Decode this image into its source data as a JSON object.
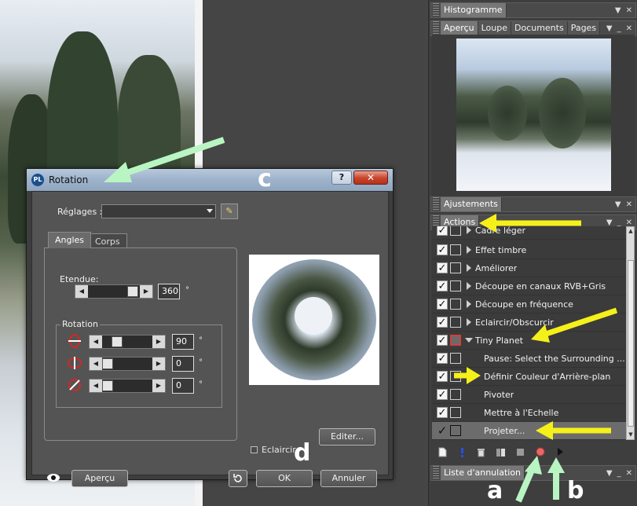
{
  "panels": {
    "histogram": {
      "title": "Histogramme"
    },
    "navigator": {
      "tabs": [
        "Aperçu",
        "Loupe",
        "Documents",
        "Pages"
      ]
    },
    "adjustments": {
      "title": "Ajustements"
    },
    "actions": {
      "title": "Actions",
      "items": [
        {
          "label": "Cadre léger",
          "type": "group",
          "checked": true
        },
        {
          "label": "Effet timbre",
          "type": "group",
          "checked": true
        },
        {
          "label": "Améliorer",
          "type": "group",
          "checked": true
        },
        {
          "label": "Découpe en canaux RVB+Gris",
          "type": "group",
          "checked": true
        },
        {
          "label": "Découpe en fréquence",
          "type": "group",
          "checked": true
        },
        {
          "label": "Eclaircir/Obscurcir",
          "type": "group",
          "checked": true
        },
        {
          "label": "Tiny Planet",
          "type": "group-open",
          "checked": true
        },
        {
          "label": "Pause: Select the Surrounding ...",
          "type": "step",
          "checked": true
        },
        {
          "label": "Définir Couleur d'Arrière-plan",
          "type": "step",
          "checked": true
        },
        {
          "label": "Pivoter",
          "type": "step",
          "checked": true
        },
        {
          "label": "Mettre à l'Echelle",
          "type": "step",
          "checked": true
        },
        {
          "label": "Projeter...",
          "type": "step",
          "checked": true,
          "selected": true
        }
      ]
    },
    "history": {
      "title": "Liste d'annulation"
    }
  },
  "dialog": {
    "title": "Rotation",
    "logo": "PL",
    "help_label": "?",
    "close_label": "✕",
    "settings_label": "Réglages :",
    "settings_value": "",
    "tabs": [
      "Angles",
      "Corps"
    ],
    "extent_label": "Etendue:",
    "extent_value": "360",
    "degree_symbol": "°",
    "rotation_label": "Rotation",
    "rotation_values": [
      "90",
      "0",
      "0"
    ],
    "eclaircir_label": "Eclaircir",
    "edit_button": "Editer...",
    "preview_button": "Aperçu",
    "ok_button": "OK",
    "cancel_button": "Annuler"
  },
  "annotations": {
    "a": "a",
    "b": "b",
    "c": "c",
    "d": "d"
  },
  "colors": {
    "arrow_yellow": "#f6f01a",
    "arrow_green": "#b9f5c3",
    "accent_red": "#c7432b"
  },
  "icons": [
    "new-action-icon",
    "info-icon",
    "delete-icon",
    "split-icon",
    "stop-icon",
    "record-icon",
    "play-icon",
    "eye-icon",
    "reset-icon"
  ]
}
